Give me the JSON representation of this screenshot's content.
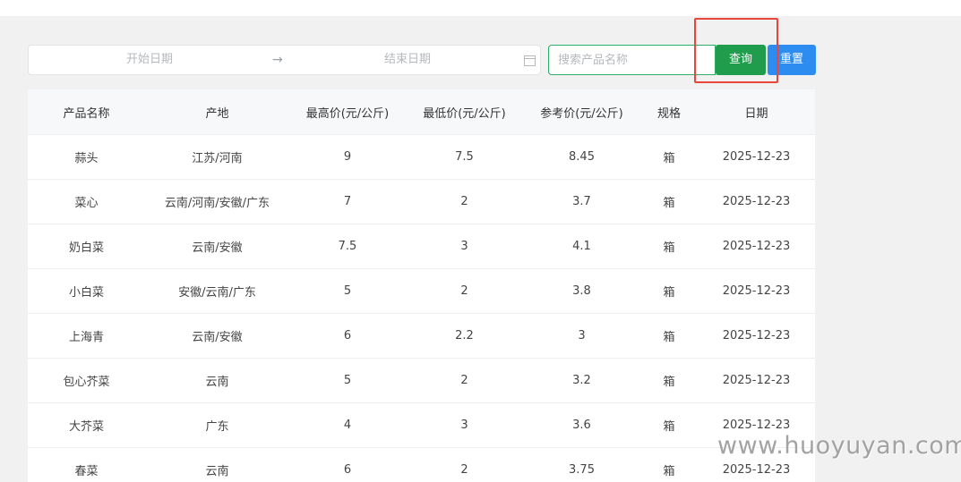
{
  "filters": {
    "start_date_placeholder": "开始日期",
    "end_date_placeholder": "结束日期",
    "range_separator": "→",
    "search_placeholder": "搜索产品名称",
    "search_value": "",
    "query_label": "查询",
    "reset_label": "重置"
  },
  "table": {
    "headers": [
      "产品名称",
      "产地",
      "最高价(元/公斤)",
      "最低价(元/公斤)",
      "参考价(元/公斤)",
      "规格",
      "日期"
    ],
    "rows": [
      [
        "蒜头",
        "江苏/河南",
        "9",
        "7.5",
        "8.45",
        "箱",
        "2025-12-23"
      ],
      [
        "菜心",
        "云南/河南/安徽/广东",
        "7",
        "2",
        "3.7",
        "箱",
        "2025-12-23"
      ],
      [
        "奶白菜",
        "云南/安徽",
        "7.5",
        "3",
        "4.1",
        "箱",
        "2025-12-23"
      ],
      [
        "小白菜",
        "安徽/云南/广东",
        "5",
        "2",
        "3.8",
        "箱",
        "2025-12-23"
      ],
      [
        "上海青",
        "云南/安徽",
        "6",
        "2.2",
        "3",
        "箱",
        "2025-12-23"
      ],
      [
        "包心芥菜",
        "云南",
        "5",
        "2",
        "3.2",
        "箱",
        "2025-12-23"
      ],
      [
        "大芥菜",
        "广东",
        "4",
        "3",
        "3.6",
        "箱",
        "2025-12-23"
      ],
      [
        "春菜",
        "云南",
        "6",
        "2",
        "3.75",
        "箱",
        "2025-12-23"
      ]
    ]
  },
  "watermark": "www.huoyuyan.com",
  "colors": {
    "query_button": "#1f9d4c",
    "reset_button": "#2d8cf0",
    "highlight": "#e8453c",
    "search_border": "#2fae66"
  }
}
